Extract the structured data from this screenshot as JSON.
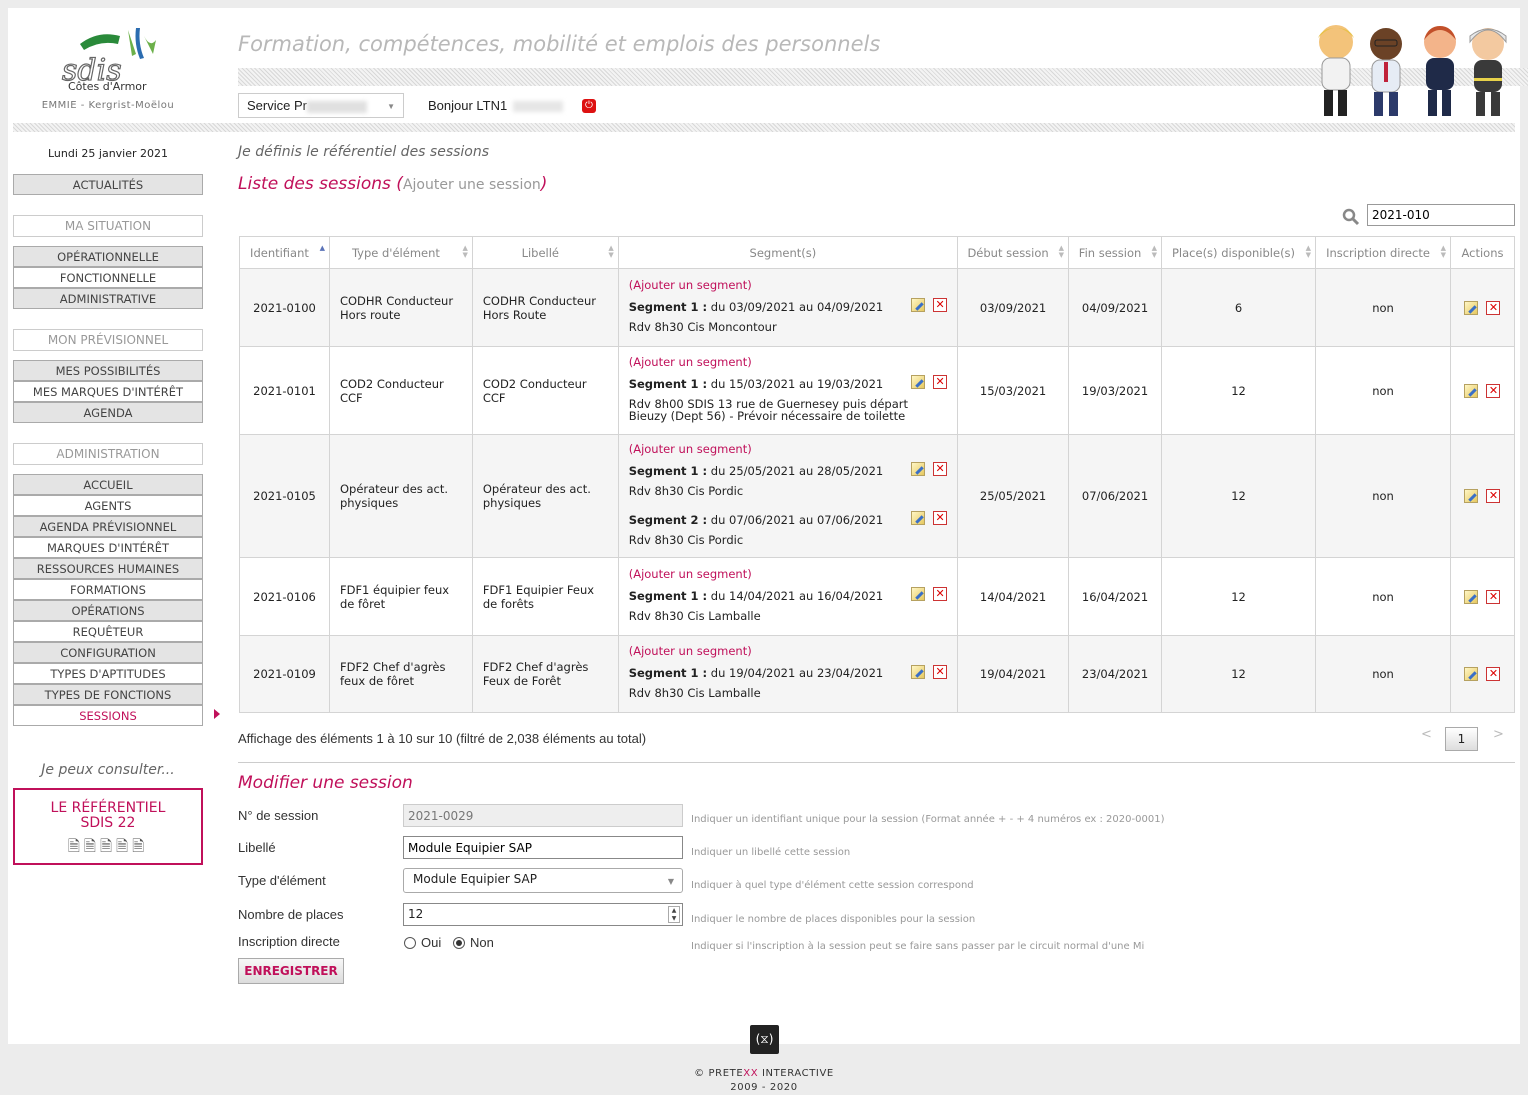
{
  "header": {
    "logo_text": "sdis",
    "logo_region": "Côtes d'Armor",
    "logo_sub": "EMMIE - Kergrist-Moëlou",
    "app_title": "Formation, compétences, mobilité et emplois des personnels",
    "service_label": "Service Pr",
    "greeting": "Bonjour LTN1"
  },
  "sidebar": {
    "date": "Lundi 25 janvier 2021",
    "actualites": "ACTUALITÉS",
    "sections": [
      {
        "title": "MA SITUATION",
        "items": [
          "OPÉRATIONNELLE",
          "FONCTIONNELLE",
          "ADMINISTRATIVE"
        ]
      },
      {
        "title": "MON PRÉVISIONNEL",
        "items": [
          "MES POSSIBILITÉS",
          "MES MARQUES D'INTÉRÊT",
          "AGENDA"
        ]
      },
      {
        "title": "ADMINISTRATION",
        "items": [
          "ACCUEIL",
          "AGENTS",
          "AGENDA PRÉVISIONNEL",
          "MARQUES D'INTÉRÊT",
          "RESSOURCES HUMAINES",
          "FORMATIONS",
          "OPÉRATIONS",
          "REQUÊTEUR",
          "CONFIGURATION",
          "TYPES D'APTITUDES",
          "TYPES DE FONCTIONS",
          "SESSIONS"
        ]
      }
    ],
    "consult_title": "Je peux consulter...",
    "ref_line1": "LE RÉFÉRENTIEL",
    "ref_line2": "SDIS 22"
  },
  "main": {
    "heading": "Je définis le référentiel des sessions",
    "list_title": "Liste des sessions",
    "add_session": "Ajouter une session",
    "search_value": "2021-010",
    "columns": [
      "Identifiant",
      "Type d'élément",
      "Libellé",
      "Segment(s)",
      "Début session",
      "Fin session",
      "Place(s) disponible(s)",
      "Inscription directe",
      "Actions"
    ],
    "add_segment": "(Ajouter un segment)",
    "rows": [
      {
        "id": "2021-0100",
        "type": "CODHR Conducteur Hors route",
        "label": "CODHR Conducteur Hors Route",
        "segments": [
          {
            "title": "Segment 1 :",
            "dates": "du 03/09/2021 au 04/09/2021",
            "rdv": "Rdv 8h30 Cis Moncontour"
          }
        ],
        "start": "03/09/2021",
        "end": "04/09/2021",
        "places": "6",
        "direct": "non"
      },
      {
        "id": "2021-0101",
        "type": "COD2 Conducteur CCF",
        "label": "COD2 Conducteur CCF",
        "segments": [
          {
            "title": "Segment 1 :",
            "dates": "du 15/03/2021 au 19/03/2021",
            "rdv": "Rdv 8h00 SDIS 13 rue de Guernesey puis départ Bieuzy (Dept 56) - Prévoir nécessaire de toilette"
          }
        ],
        "start": "15/03/2021",
        "end": "19/03/2021",
        "places": "12",
        "direct": "non"
      },
      {
        "id": "2021-0105",
        "type": "Opérateur des act. physiques",
        "label": "Opérateur des act. physiques",
        "segments": [
          {
            "title": "Segment 1 :",
            "dates": "du 25/05/2021 au 28/05/2021",
            "rdv": "Rdv 8h30 Cis Pordic"
          },
          {
            "title": "Segment 2 :",
            "dates": "du 07/06/2021 au 07/06/2021",
            "rdv": "Rdv 8h30 Cis Pordic"
          }
        ],
        "start": "25/05/2021",
        "end": "07/06/2021",
        "places": "12",
        "direct": "non"
      },
      {
        "id": "2021-0106",
        "type": "FDF1 équipier feux de fôret",
        "label": "FDF1 Equipier Feux de forêts",
        "segments": [
          {
            "title": "Segment 1 :",
            "dates": "du 14/04/2021 au 16/04/2021",
            "rdv": "Rdv 8h30 Cis Lamballe"
          }
        ],
        "start": "14/04/2021",
        "end": "16/04/2021",
        "places": "12",
        "direct": "non"
      },
      {
        "id": "2021-0109",
        "type": "FDF2 Chef d'agrès feux de fôret",
        "label": "FDF2 Chef d'agrès Feux de Forêt",
        "segments": [
          {
            "title": "Segment 1 :",
            "dates": "du 19/04/2021 au 23/04/2021",
            "rdv": "Rdv 8h30 Cis Lamballe"
          }
        ],
        "start": "19/04/2021",
        "end": "23/04/2021",
        "places": "12",
        "direct": "non"
      }
    ],
    "info": "Affichage des éléments 1 à 10 sur 10 (filtré de 2,038 éléments au total)",
    "pager": {
      "prev": "<",
      "page": "1",
      "next": ">"
    }
  },
  "form": {
    "title": "Modifier une session",
    "num_label": "N° de session",
    "num_value": "2021-0029",
    "num_hint": "Indiquer un identifiant unique pour la session (Format année + - + 4 numéros ex : 2020-0001)",
    "lib_label": "Libellé",
    "lib_value": "Module Equipier SAP",
    "lib_hint": "Indiquer un libellé cette session",
    "type_label": "Type d'élément",
    "type_value": "Module Equipier SAP",
    "type_hint": "Indiquer à quel type d'élément cette session correspond",
    "places_label": "Nombre de places",
    "places_value": "12",
    "places_hint": "Indiquer le nombre de places disponibles pour la session",
    "direct_label": "Inscription directe",
    "oui": "Oui",
    "non": "Non",
    "direct_selected": "Non",
    "direct_hint": "Indiquer si l'inscription à la session peut se faire sans passer par le circuit normal d'une Mi",
    "save": "ENREGISTRER"
  },
  "footer": {
    "copyright_pre": "© PRETE",
    "copyright_xx": "XX",
    "copyright_post": " INTERACTIVE",
    "years": "2009 - 2020"
  },
  "colors": {
    "accent": "#c0105a",
    "logo_green": "#2a8a3a",
    "logo_blue": "#2b6cb0"
  }
}
